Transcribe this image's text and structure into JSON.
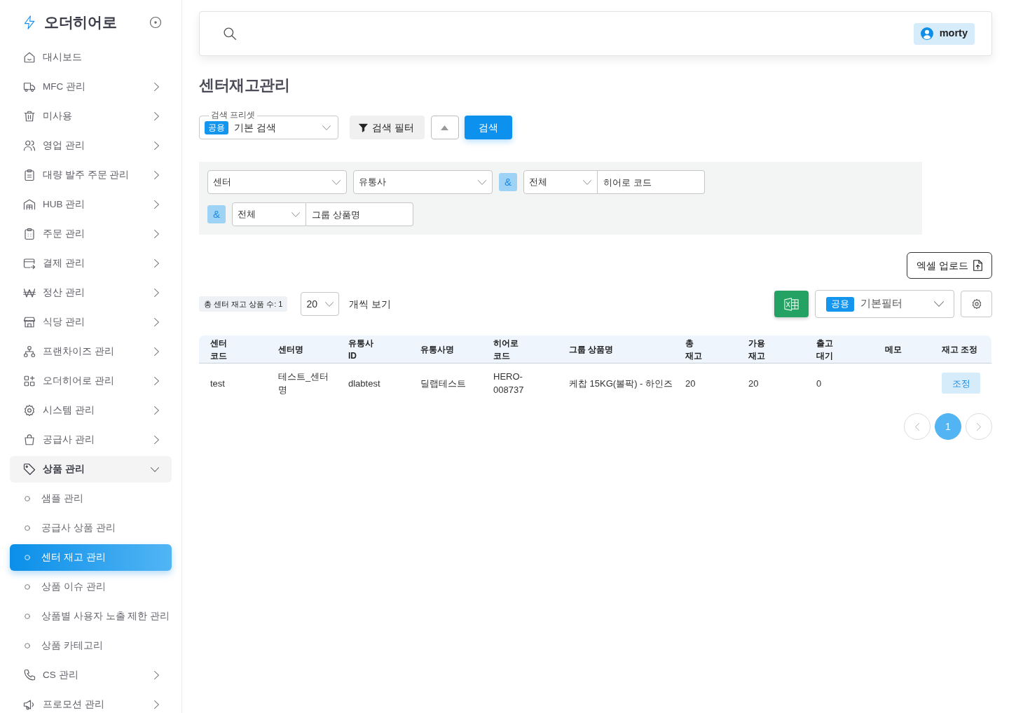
{
  "sidebar": {
    "brand": "오더히어로",
    "items": [
      {
        "kind": "link",
        "label": "대시보드",
        "selected": false
      },
      {
        "kind": "group",
        "label": "MFC 관리",
        "selected": false,
        "expanded": false
      },
      {
        "kind": "group",
        "label": "미사용",
        "selected": false,
        "expanded": false
      },
      {
        "kind": "group",
        "label": "영업 관리",
        "selected": false,
        "expanded": false
      },
      {
        "kind": "group",
        "label": "대량 발주 주문 관리",
        "selected": false,
        "expanded": false
      },
      {
        "kind": "group",
        "label": "HUB 관리",
        "selected": false,
        "expanded": false
      },
      {
        "kind": "group",
        "label": "주문 관리",
        "selected": false,
        "expanded": false
      },
      {
        "kind": "group",
        "label": "결제 관리",
        "selected": false,
        "expanded": false
      },
      {
        "kind": "group",
        "label": "정산 관리",
        "selected": false,
        "expanded": false
      },
      {
        "kind": "group",
        "label": "식당 관리",
        "selected": false,
        "expanded": false
      },
      {
        "kind": "group",
        "label": "프랜차이즈 관리",
        "selected": false,
        "expanded": false
      },
      {
        "kind": "group",
        "label": "오더히어로 관리",
        "selected": false,
        "expanded": false
      },
      {
        "kind": "group",
        "label": "시스템 관리",
        "selected": false,
        "expanded": false
      },
      {
        "kind": "group",
        "label": "공급사 관리",
        "selected": false,
        "expanded": false
      },
      {
        "kind": "group",
        "label": "상품 관리",
        "selected": false,
        "expanded": true,
        "children": [
          {
            "label": "샘플 관리",
            "selected": false
          },
          {
            "label": "공급사 상품 관리",
            "selected": false
          },
          {
            "label": "센터 재고 관리",
            "selected": true
          },
          {
            "label": "상품 이슈 관리",
            "selected": false
          },
          {
            "label": "상품별 사용자 노출 제한 관리",
            "selected": false
          },
          {
            "label": "상품 카테고리",
            "selected": false
          }
        ]
      },
      {
        "kind": "group",
        "label": "CS 관리",
        "selected": false,
        "expanded": false
      },
      {
        "kind": "group",
        "label": "프로모션 관리",
        "selected": false,
        "expanded": false
      }
    ]
  },
  "header": {
    "user": "morty"
  },
  "page_title": "센터재고관리",
  "preset": {
    "legend": "검색 프리셋",
    "badge": "공용",
    "value": "기본 검색"
  },
  "filter_button": "검색 필터",
  "search_button": "검색",
  "filter_panel": {
    "expanded": true,
    "rows": [
      [
        {
          "kind": "select",
          "value": "센터"
        },
        {
          "kind": "select",
          "value": "유통사"
        },
        {
          "kind": "operator",
          "label": "&"
        },
        {
          "kind": "select_input",
          "select": "전체",
          "placeholder": "히어로 코드"
        }
      ],
      [
        {
          "kind": "operator",
          "label": "&"
        },
        {
          "kind": "select_input",
          "select": "전체",
          "placeholder": "그룹 상품명"
        }
      ]
    ]
  },
  "excel_upload": "엑셀 업로드",
  "summary": "총 센터 재고 상품 수: 1",
  "page_size": {
    "value": "20",
    "label": "개씩 보기"
  },
  "saved_filter": {
    "badge": "공용",
    "value": "기본필터"
  },
  "table": {
    "columns": [
      {
        "label": "센터 코드",
        "kind": "text"
      },
      {
        "label": "센터명",
        "kind": "text"
      },
      {
        "label": "유통사 ID",
        "kind": "text"
      },
      {
        "label": "유통사명",
        "kind": "text"
      },
      {
        "label": "히어로 코드",
        "kind": "text"
      },
      {
        "label": "그룹 상품명",
        "kind": "text"
      },
      {
        "label": "총 재고",
        "kind": "text"
      },
      {
        "label": "가용 재고",
        "kind": "text"
      },
      {
        "label": "출고 대기",
        "kind": "text"
      },
      {
        "label": "메모",
        "kind": "memo"
      },
      {
        "label": "재고 조정",
        "kind": "action"
      }
    ],
    "rows": [
      {
        "cells": [
          "test",
          "테스트_센터명",
          "dlabtest",
          "딜랩테스트",
          "HERO-008737",
          "케찹 15KG(볼팍) - 하인즈",
          "20",
          "20",
          "0"
        ],
        "action": "조정"
      }
    ]
  },
  "pagination": {
    "pages": [
      {
        "label": "1",
        "selected": true
      }
    ]
  }
}
